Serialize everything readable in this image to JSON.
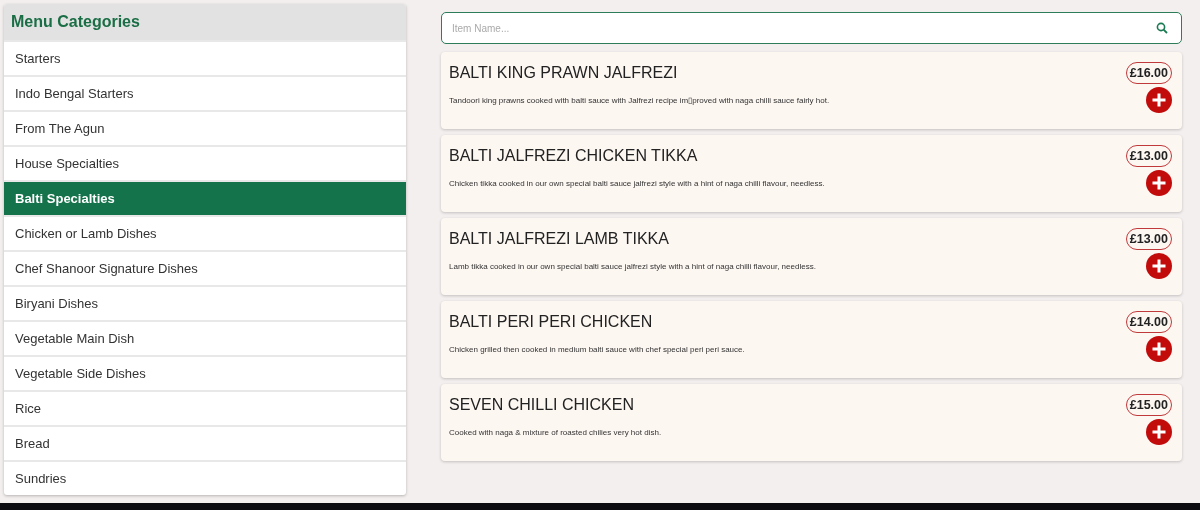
{
  "sidebar": {
    "title": "Menu Categories",
    "items": [
      {
        "label": "Starters",
        "selected": false
      },
      {
        "label": "Indo Bengal Starters",
        "selected": false
      },
      {
        "label": "From The Agun",
        "selected": false
      },
      {
        "label": "House Specialties",
        "selected": false
      },
      {
        "label": "Balti Specialties",
        "selected": true
      },
      {
        "label": "Chicken or Lamb Dishes",
        "selected": false
      },
      {
        "label": "Chef Shanoor Signature Dishes",
        "selected": false
      },
      {
        "label": "Biryani Dishes",
        "selected": false
      },
      {
        "label": "Vegetable Main Dish",
        "selected": false
      },
      {
        "label": "Vegetable Side Dishes",
        "selected": false
      },
      {
        "label": "Rice",
        "selected": false
      },
      {
        "label": "Bread",
        "selected": false
      },
      {
        "label": "Sundries",
        "selected": false
      }
    ]
  },
  "search": {
    "placeholder": "Item Name..."
  },
  "items": [
    {
      "name": "BALTI KING PRAWN JALFREZI",
      "price": "£16.00",
      "description": "Tandoori king prawns cooked with balti sauce with Jalfrezi recipe im▯proved with naga chilli sauce fairly hot."
    },
    {
      "name": "BALTI JALFREZI CHICKEN TIKKA",
      "price": "£13.00",
      "description": "Chicken tikka cooked in our own special balti sauce jalfrezi style with a hint of naga chilli flavour, needless."
    },
    {
      "name": "BALTI JALFREZI LAMB TIKKA",
      "price": "£13.00",
      "description": "Lamb tikka cooked in our own special balti sauce jalfrezi style with a hint of naga chilli flavour, needless."
    },
    {
      "name": "BALTI PERI PERI CHICKEN",
      "price": "£14.00",
      "description": "Chicken grilled then cooked in medium balti sauce with chef special peri peri sauce."
    },
    {
      "name": "SEVEN CHILLI CHICKEN",
      "price": "£15.00",
      "description": "Cooked with naga & mixture of roasted chilies very hot dish."
    }
  ]
}
